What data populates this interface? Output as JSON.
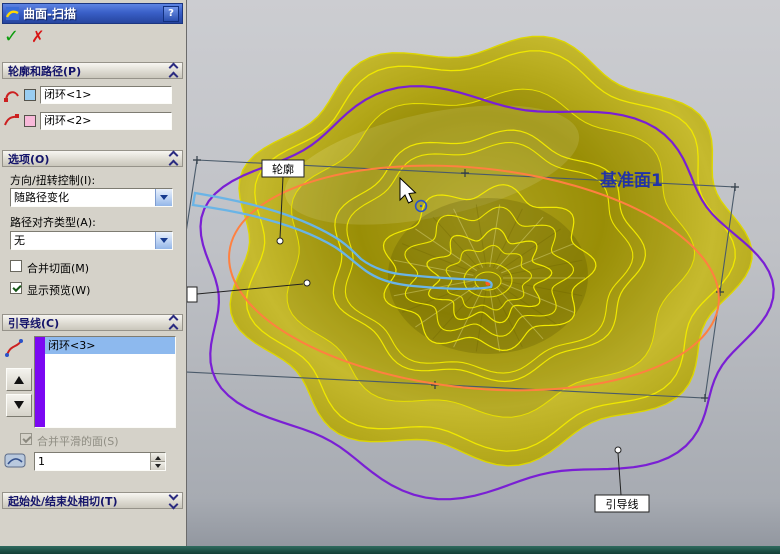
{
  "panel": {
    "title": "曲面-扫描",
    "help_label": "?",
    "ok_icon": "✓",
    "cancel_icon": "✗",
    "profile_path": {
      "header": "轮廓和路径(P)",
      "profile_value": "闭环<1>",
      "path_value": "闭环<2>"
    },
    "options": {
      "header": "选项(O)",
      "orientation_label": "方向/扭转控制(I):",
      "orientation_value": "随路径变化",
      "alignment_label": "路径对齐类型(A):",
      "alignment_value": "无",
      "merge_tangent_label": "合并切面(M)",
      "show_preview_label": "显示预览(W)"
    },
    "guide_curves": {
      "header": "引导线(C)",
      "item_label": "闭环<3>",
      "merge_smooth_label": "合并平滑的面(S)",
      "influence_value": "1"
    },
    "tangency": {
      "header": "起始处/结束处相切(T)"
    }
  },
  "viewport": {
    "plane_label": "基准面1",
    "profile_callout": "轮廓",
    "guide_callout": "引导线"
  },
  "colors": {
    "profile_swatch": "#99cdf2",
    "path_swatch": "#f8b9d9",
    "guide_swatch": "#7b08f2",
    "surface_fill": "#b2a614",
    "surface_edge": "#f0e800",
    "path_curve": "#ff8040",
    "guide_curve": "#7a1fd4",
    "profile_curve": "#6ab4e6",
    "plane_line": "#4a5a6a",
    "plane_label_color": "#2233a6"
  }
}
